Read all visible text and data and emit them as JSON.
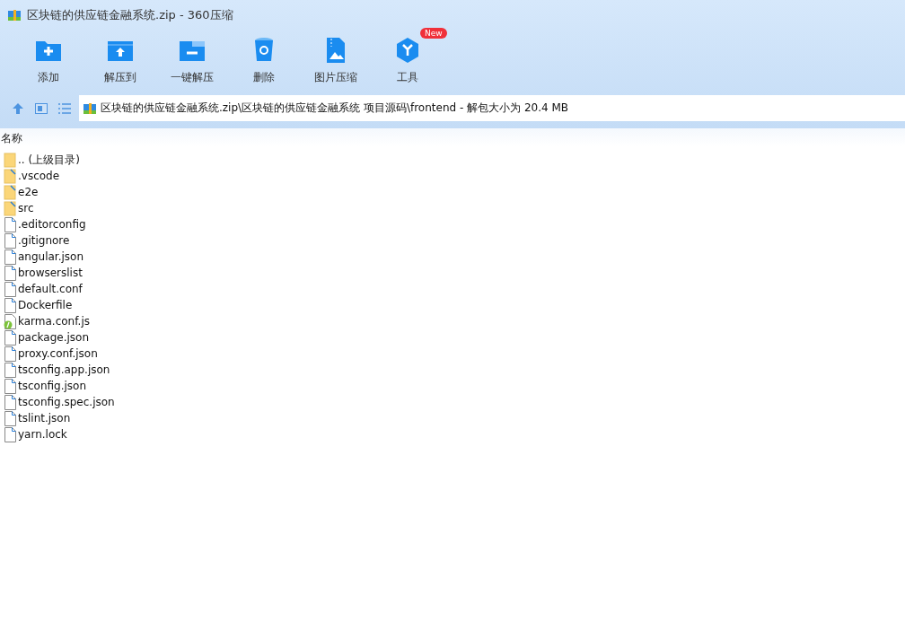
{
  "window": {
    "title": "区块链的供应链金融系统.zip - 360压缩"
  },
  "toolbar": [
    {
      "label": "添加",
      "kind": "add"
    },
    {
      "label": "解压到",
      "kind": "extract"
    },
    {
      "label": "一键解压",
      "kind": "quick"
    },
    {
      "label": "删除",
      "kind": "delete"
    },
    {
      "label": "图片压缩",
      "kind": "image"
    },
    {
      "label": "工具",
      "kind": "tools",
      "badge": "New"
    }
  ],
  "address": {
    "path": "区块链的供应链金融系统.zip\\区块链的供应链金融系统 项目源码\\frontend - 解包大小为 20.4 MB"
  },
  "table": {
    "columns": [
      "名称"
    ],
    "rows": [
      {
        "name": ".. (上级目录)",
        "kind": "parent"
      },
      {
        "name": ".vscode",
        "kind": "folder"
      },
      {
        "name": "e2e",
        "kind": "folder"
      },
      {
        "name": "src",
        "kind": "folder"
      },
      {
        "name": ".editorconfig",
        "kind": "file"
      },
      {
        "name": ".gitignore",
        "kind": "file"
      },
      {
        "name": "angular.json",
        "kind": "file"
      },
      {
        "name": "browserslist",
        "kind": "file"
      },
      {
        "name": "default.conf",
        "kind": "file"
      },
      {
        "name": "Dockerfile",
        "kind": "file"
      },
      {
        "name": "karma.conf.js",
        "kind": "script"
      },
      {
        "name": "package.json",
        "kind": "file"
      },
      {
        "name": "proxy.conf.json",
        "kind": "file"
      },
      {
        "name": "tsconfig.app.json",
        "kind": "file"
      },
      {
        "name": "tsconfig.json",
        "kind": "file"
      },
      {
        "name": "tsconfig.spec.json",
        "kind": "file"
      },
      {
        "name": "tslint.json",
        "kind": "file"
      },
      {
        "name": "yarn.lock",
        "kind": "file"
      }
    ]
  }
}
